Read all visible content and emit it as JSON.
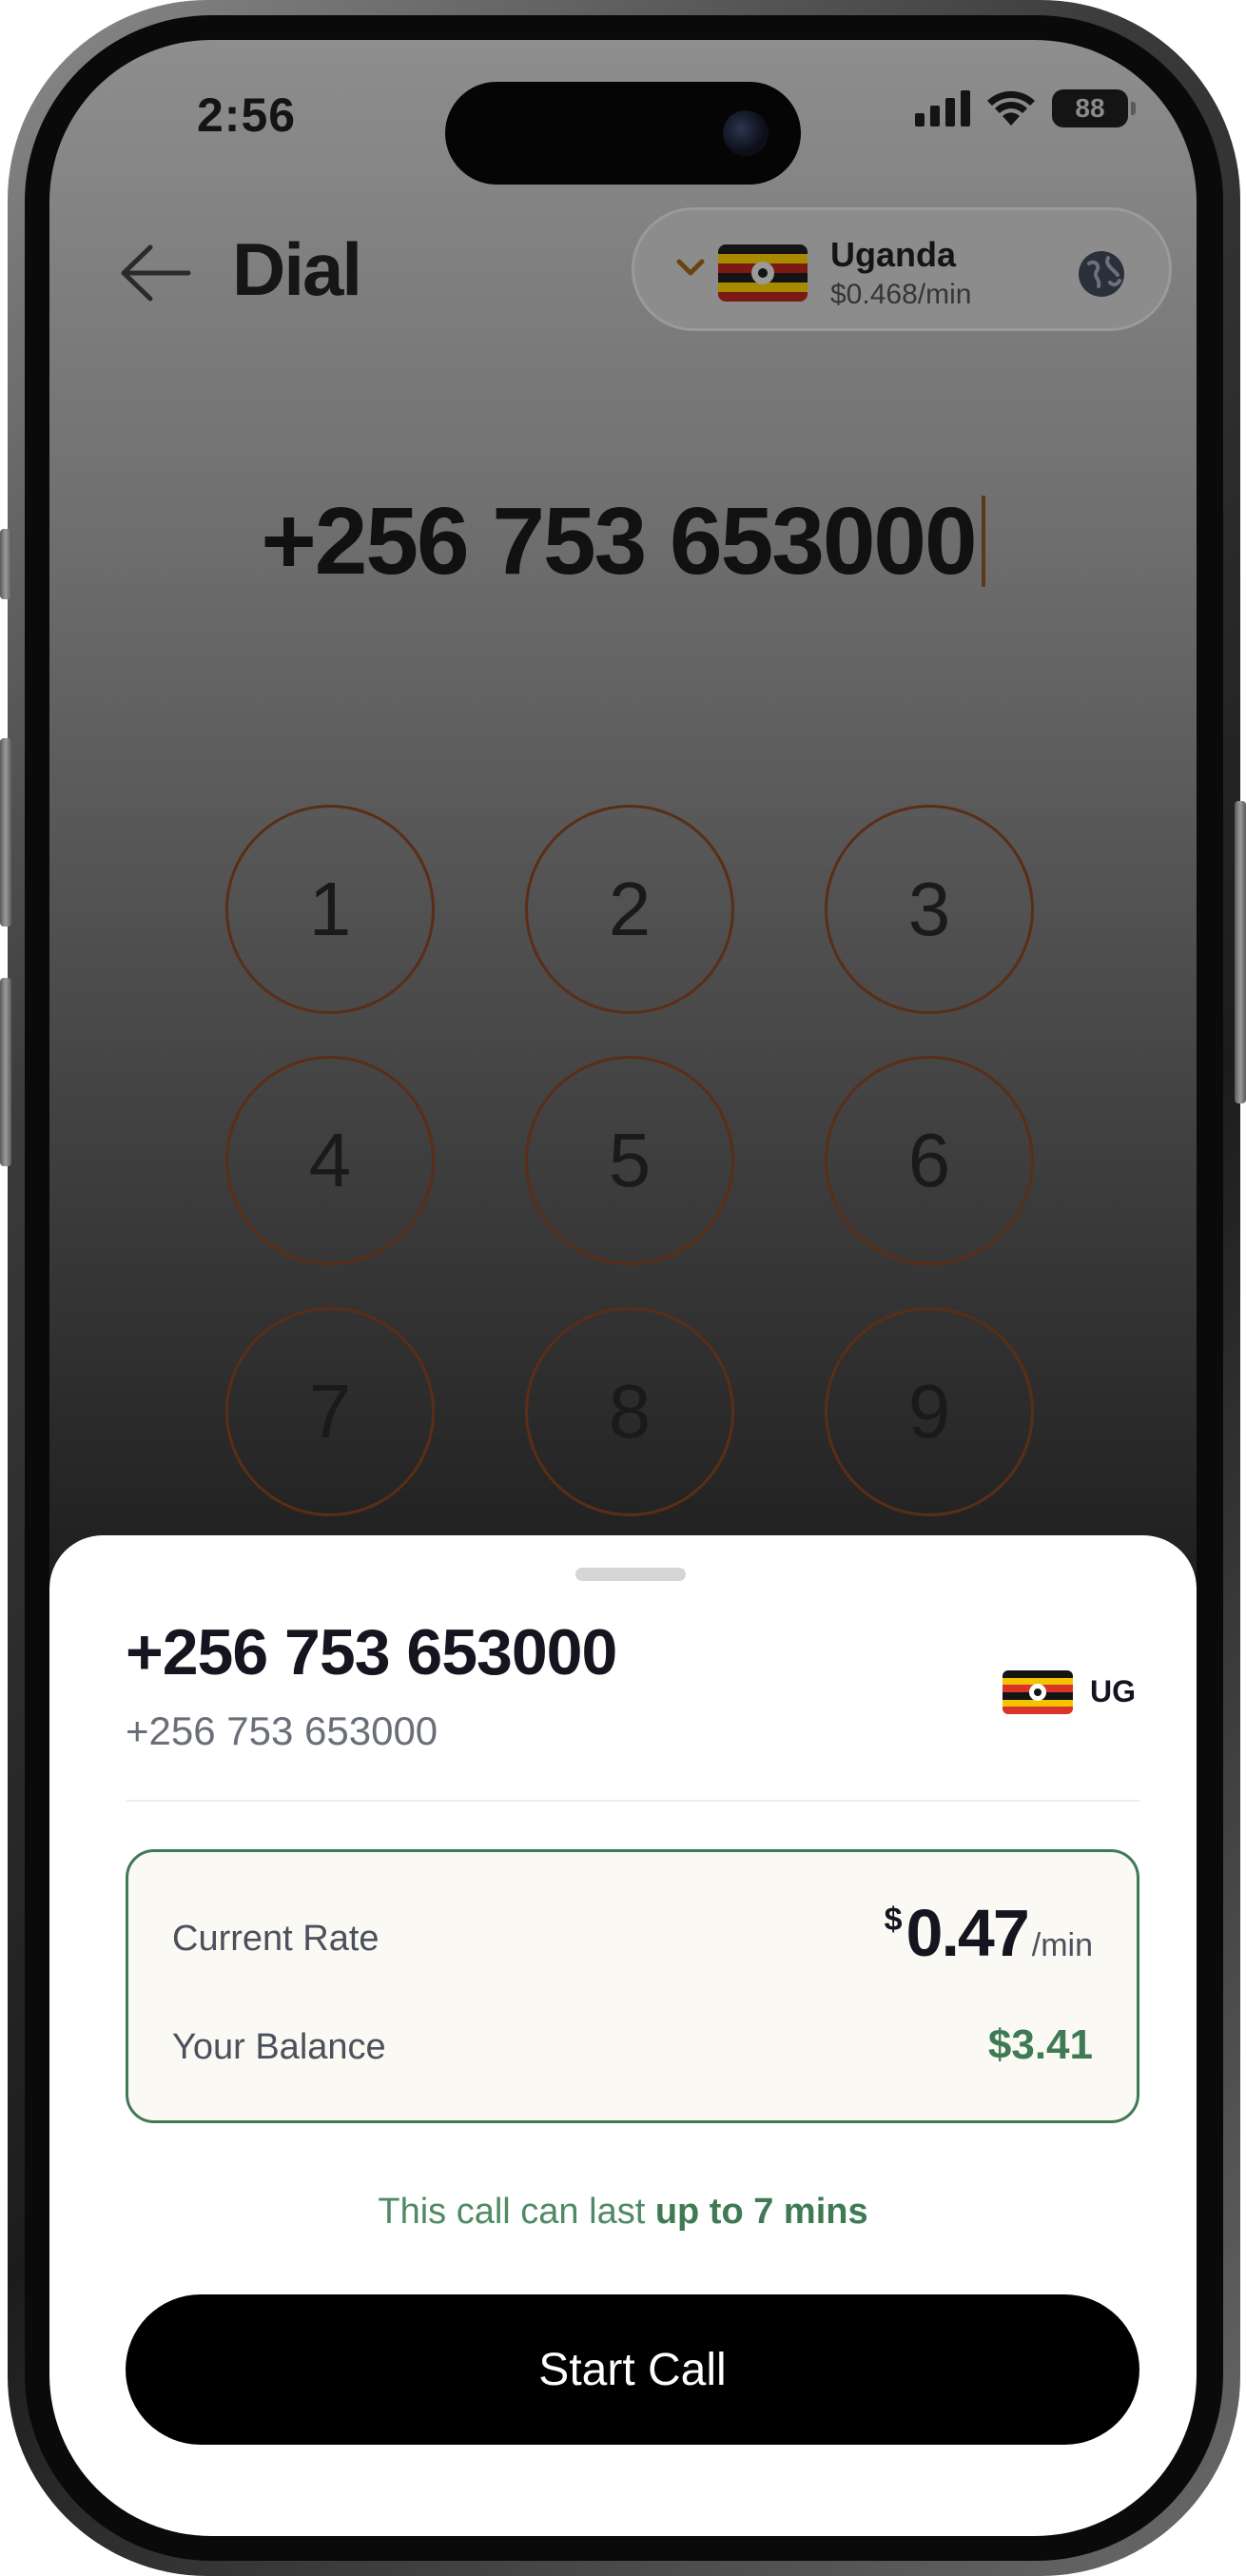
{
  "status_bar": {
    "time": "2:56",
    "battery": "88"
  },
  "header": {
    "title": "Dial"
  },
  "country_selector": {
    "name": "Uganda",
    "rate": "$0.468/min"
  },
  "dialer": {
    "number": "+256 753 653000",
    "keys": [
      "1",
      "2",
      "3",
      "4",
      "5",
      "6",
      "7",
      "8",
      "9"
    ]
  },
  "sheet": {
    "number": "+256 753 653000",
    "subtitle": "+256 753 653000",
    "country_code": "UG",
    "rate_label": "Current Rate",
    "rate_currency": "$",
    "rate_value": "0.47",
    "rate_unit": "/min",
    "balance_label": "Your Balance",
    "balance_value": "$3.41",
    "call_note_prefix": "This call can last",
    "call_note_emphasis": "up to 7 mins",
    "start_button": "Start Call"
  },
  "colors": {
    "accent_green": "#3f7a55",
    "key_border": "#5a2e16",
    "button_bg": "#000000"
  },
  "icons": [
    "back-arrow-icon",
    "chevron-down-icon",
    "globe-icon",
    "signal-icon",
    "wifi-icon",
    "battery-icon",
    "uganda-flag-icon"
  ]
}
